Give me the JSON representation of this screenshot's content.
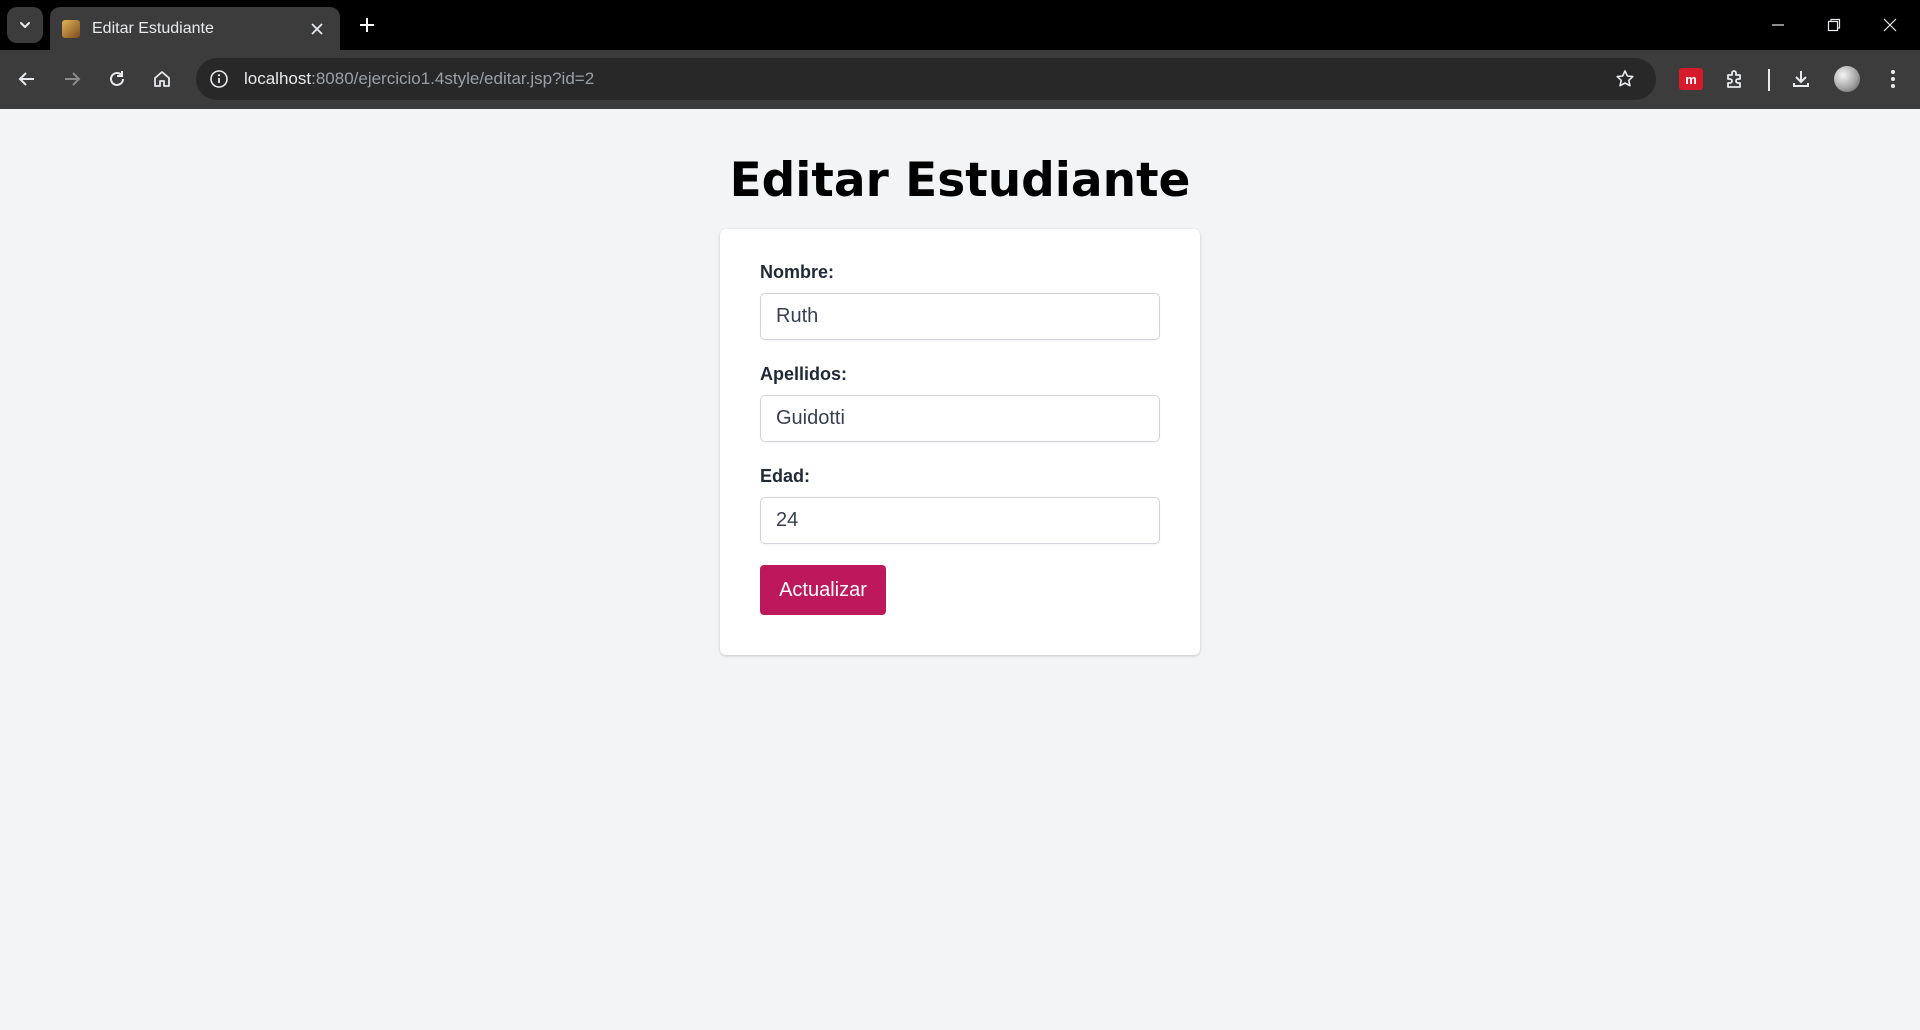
{
  "browser": {
    "tab_title": "Editar Estudiante",
    "url_host": "localhost",
    "url_path": ":8080/ejercicio1.4style/editar.jsp?id=2",
    "extension_label": "m"
  },
  "page": {
    "title": "Editar Estudiante",
    "form": {
      "nombre_label": "Nombre:",
      "nombre_value": "Ruth",
      "apellidos_label": "Apellidos:",
      "apellidos_value": "Guidotti",
      "edad_label": "Edad:",
      "edad_value": "24",
      "submit_label": "Actualizar"
    }
  },
  "colors": {
    "accent": "#be185d",
    "page_background": "#f3f4f6",
    "chrome_dark": "#3c3c3c"
  }
}
